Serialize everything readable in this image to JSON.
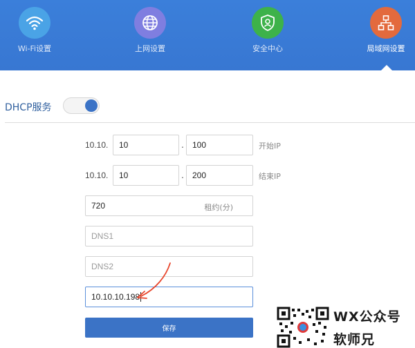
{
  "nav": {
    "items": [
      {
        "label": "Wi-Fi设置",
        "icon": "wifi-icon",
        "color": "#4aa3e6"
      },
      {
        "label": "上网设置",
        "icon": "globe-icon",
        "color": "#7f7ee0"
      },
      {
        "label": "安全中心",
        "icon": "shield-user-icon",
        "color": "#3db24a"
      },
      {
        "label": "局域网设置",
        "icon": "lan-network-icon",
        "color": "#e36a3d"
      }
    ],
    "active_index": 3
  },
  "dhcp": {
    "title": "DHCP服务",
    "enabled": true
  },
  "form": {
    "ip_prefix": "10.10.",
    "start": {
      "octet3": "10",
      "octet4": "100",
      "label": "开始IP"
    },
    "end": {
      "octet3": "10",
      "octet4": "200",
      "label": "结束IP"
    },
    "lease": {
      "value": "720",
      "unit": "租约(分)"
    },
    "dns1": {
      "placeholder": "DNS1"
    },
    "dns2": {
      "placeholder": "DNS2"
    },
    "gateway_value": "10.10.10.198",
    "dot": "."
  },
  "save_label": "保存",
  "watermark": {
    "line1": "WX公众号",
    "line2": "软师兄"
  },
  "colors": {
    "primary": "#3b73c6",
    "nav_bg": "#3a7bd5",
    "annotation": "#e8462c"
  }
}
